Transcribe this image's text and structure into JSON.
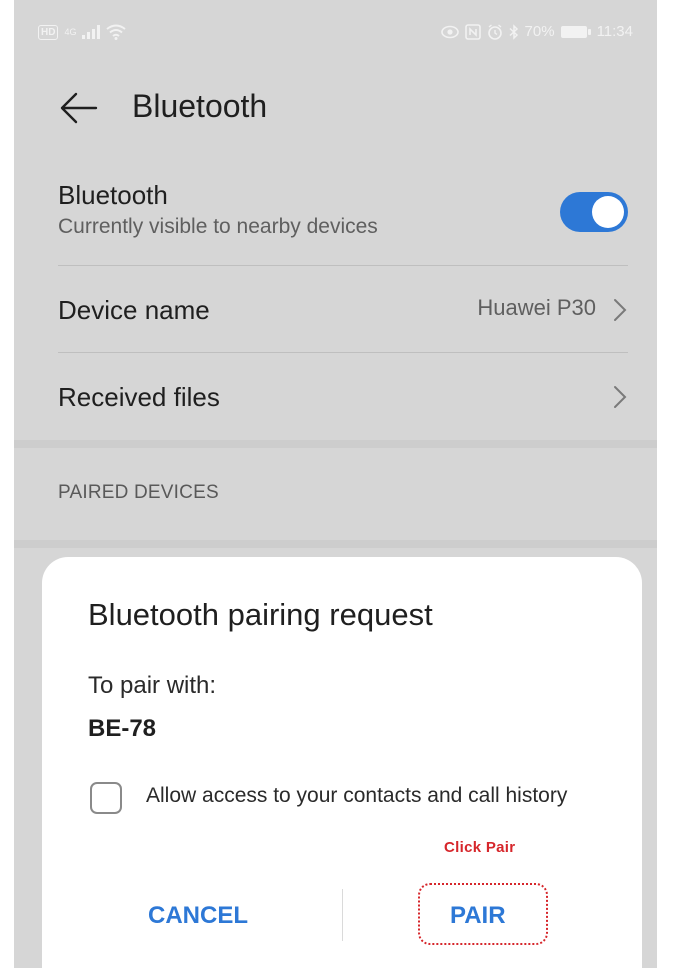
{
  "status_bar": {
    "left_badge": "HD",
    "network": "4G",
    "battery": "70%",
    "time": "11:34"
  },
  "header": {
    "title": "Bluetooth"
  },
  "settings": {
    "bluetooth": {
      "title": "Bluetooth",
      "subtitle": "Currently visible to nearby devices",
      "enabled": true
    },
    "device_name": {
      "title": "Device name",
      "value": "Huawei P30"
    },
    "received_files": {
      "title": "Received files"
    },
    "section_paired": "PAIRED DEVICES"
  },
  "dialog": {
    "title": "Bluetooth pairing request",
    "text": "To pair with:",
    "device": "BE-78",
    "checkbox_label": "Allow access to your contacts and call history",
    "checkbox_checked": false,
    "annotation": "Click Pair",
    "cancel_label": "CANCEL",
    "pair_label": "PAIR"
  },
  "colors": {
    "accent": "#2d78d6",
    "annotation": "#d6262b"
  }
}
